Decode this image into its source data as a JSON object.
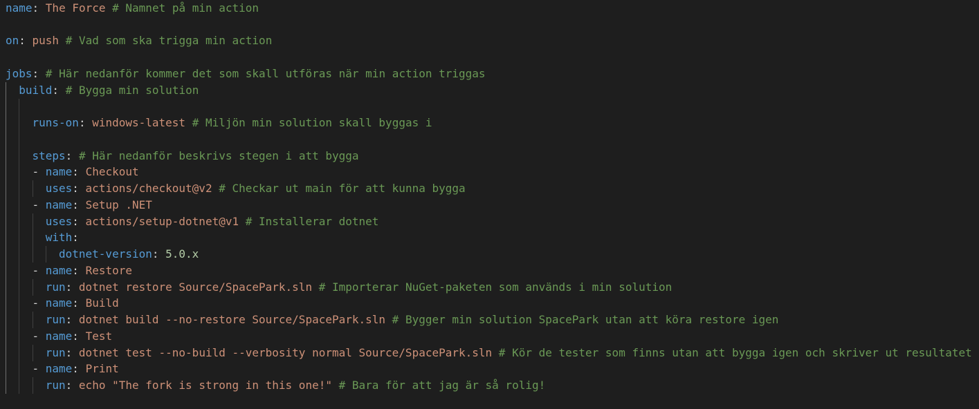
{
  "editor": {
    "language": "yaml",
    "colors": {
      "background": "#1e1e1e",
      "key": "#569cd6",
      "string": "#ce9178",
      "number": "#b5cea8",
      "comment": "#6a9955",
      "text": "#d4d4d4",
      "indent_guide": "#404040"
    },
    "lines": [
      {
        "key": "name",
        "value": "The Force",
        "comment": "# Namnet på min action"
      },
      {
        "key": "on",
        "value": "push",
        "comment": "# Vad som ska trigga min action"
      },
      {
        "key": "jobs",
        "comment": "# Här nedanför kommer det som skall utföras när min action triggas"
      },
      {
        "key": "build",
        "comment": "# Bygga min solution"
      },
      {
        "key": "runs-on",
        "value": "windows-latest",
        "comment": "# Miljön min solution skall byggas i"
      },
      {
        "key": "steps",
        "comment": "# Här nedanför beskrivs stegen i att bygga"
      },
      {
        "dash": "- ",
        "key": "name",
        "value": "Checkout"
      },
      {
        "key": "uses",
        "value": "actions/checkout@v2",
        "comment": "# Checkar ut main för att kunna bygga"
      },
      {
        "dash": "- ",
        "key": "name",
        "value": "Setup .NET"
      },
      {
        "key": "uses",
        "value": "actions/setup-dotnet@v1",
        "comment": "# Installerar dotnet"
      },
      {
        "key": "with"
      },
      {
        "key": "dotnet-version",
        "value": "5.0.x"
      },
      {
        "dash": "- ",
        "key": "name",
        "value": "Restore"
      },
      {
        "key": "run",
        "value": "dotnet restore Source/SpacePark.sln",
        "comment": "# Importerar NuGet-paketen som används i min solution"
      },
      {
        "dash": "- ",
        "key": "name",
        "value": "Build"
      },
      {
        "key": "run",
        "value": "dotnet build --no-restore Source/SpacePark.sln",
        "comment": "# Bygger min solution SpacePark utan att köra restore igen"
      },
      {
        "dash": "- ",
        "key": "name",
        "value": "Test"
      },
      {
        "key": "run",
        "value": "dotnet test --no-build --verbosity normal Source/SpacePark.sln",
        "comment": "# Kör de tester som finns utan att bygga igen och skriver ut resultatet"
      },
      {
        "dash": "- ",
        "key": "name",
        "value": "Print"
      },
      {
        "key": "run",
        "value": "echo \"The fork is strong in this one!\"",
        "comment": "# Bara för att jag är så rolig!"
      }
    ]
  }
}
